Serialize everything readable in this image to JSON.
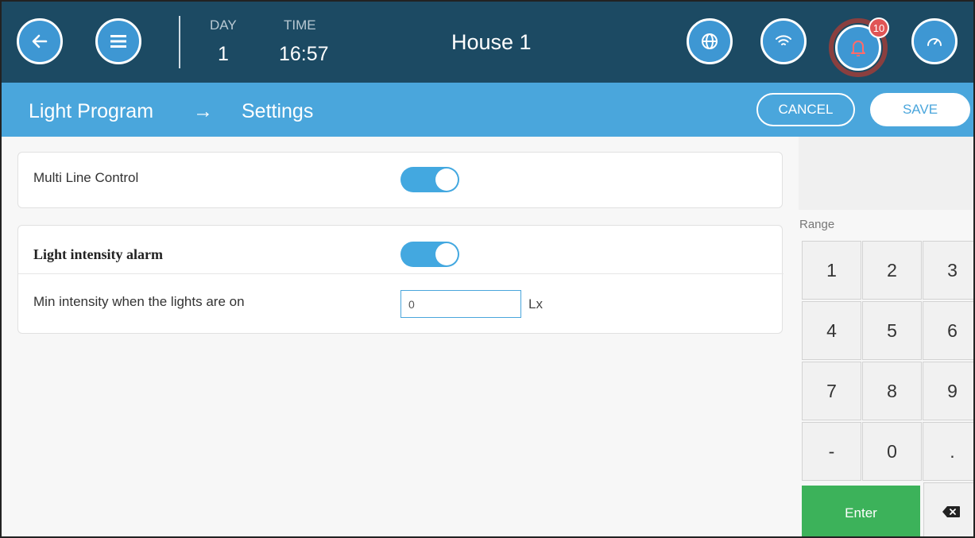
{
  "header": {
    "day_label": "DAY",
    "day_value": "1",
    "time_label": "TIME",
    "time_value": "16:57",
    "title": "House 1",
    "alarm_count": "10",
    "icons": [
      "back-arrow-icon",
      "menu-icon",
      "globe-icon",
      "wifi-icon",
      "bell-icon",
      "gauge-icon"
    ]
  },
  "subheader": {
    "section": "Light Program",
    "arrow": "→",
    "page": "Settings",
    "cancel_label": "CANCEL",
    "save_label": "SAVE"
  },
  "settings": {
    "multi_line_label": "Multi Line Control",
    "multi_line_on": true,
    "alarm_label": "Light intensity alarm",
    "alarm_on": true,
    "min_intensity_label": "Min intensity when the lights are on",
    "min_intensity_value": "0",
    "min_intensity_unit": "Lx"
  },
  "keypad": {
    "range_label": "Range",
    "keys": [
      "1",
      "2",
      "3",
      "4",
      "5",
      "6",
      "7",
      "8",
      "9",
      "-",
      "0",
      "."
    ],
    "enter_label": "Enter"
  },
  "colors": {
    "topbar": "#1c4a63",
    "subbar": "#4aa6dc",
    "button_blue": "#3e97d3",
    "toggle_on": "#43a8e0",
    "enter_green": "#3cb25a",
    "badge_red": "#e05555"
  }
}
